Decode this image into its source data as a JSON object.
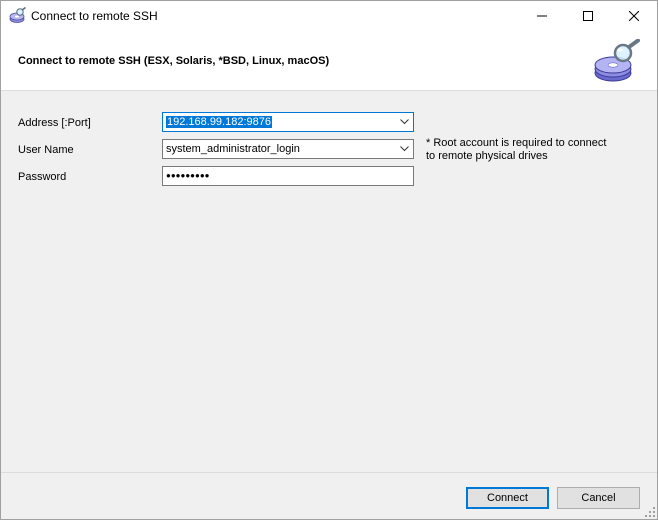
{
  "window": {
    "title": "Connect to remote SSH",
    "controls": {
      "minimize": "minimize-icon",
      "maximize": "maximize-icon",
      "close": "close-icon"
    }
  },
  "header": {
    "title": "Connect to remote SSH (ESX, Solaris, *BSD, Linux, macOS)",
    "icon": "disk-search-icon"
  },
  "form": {
    "address": {
      "label": "Address [:Port]",
      "value": "192.168.99.182:9876"
    },
    "username": {
      "label": "User Name",
      "value": "system_administrator_login"
    },
    "password": {
      "label": "Password",
      "value": "●●●●●●●●●"
    },
    "note_line1": "* Root account is required to connect",
    "note_line2": "to remote physical drives"
  },
  "footer": {
    "connect_label": "Connect",
    "cancel_label": "Cancel"
  },
  "colors": {
    "accent": "#0078d7",
    "window_bg": "#f0f0f0",
    "header_bg": "#ffffff"
  }
}
